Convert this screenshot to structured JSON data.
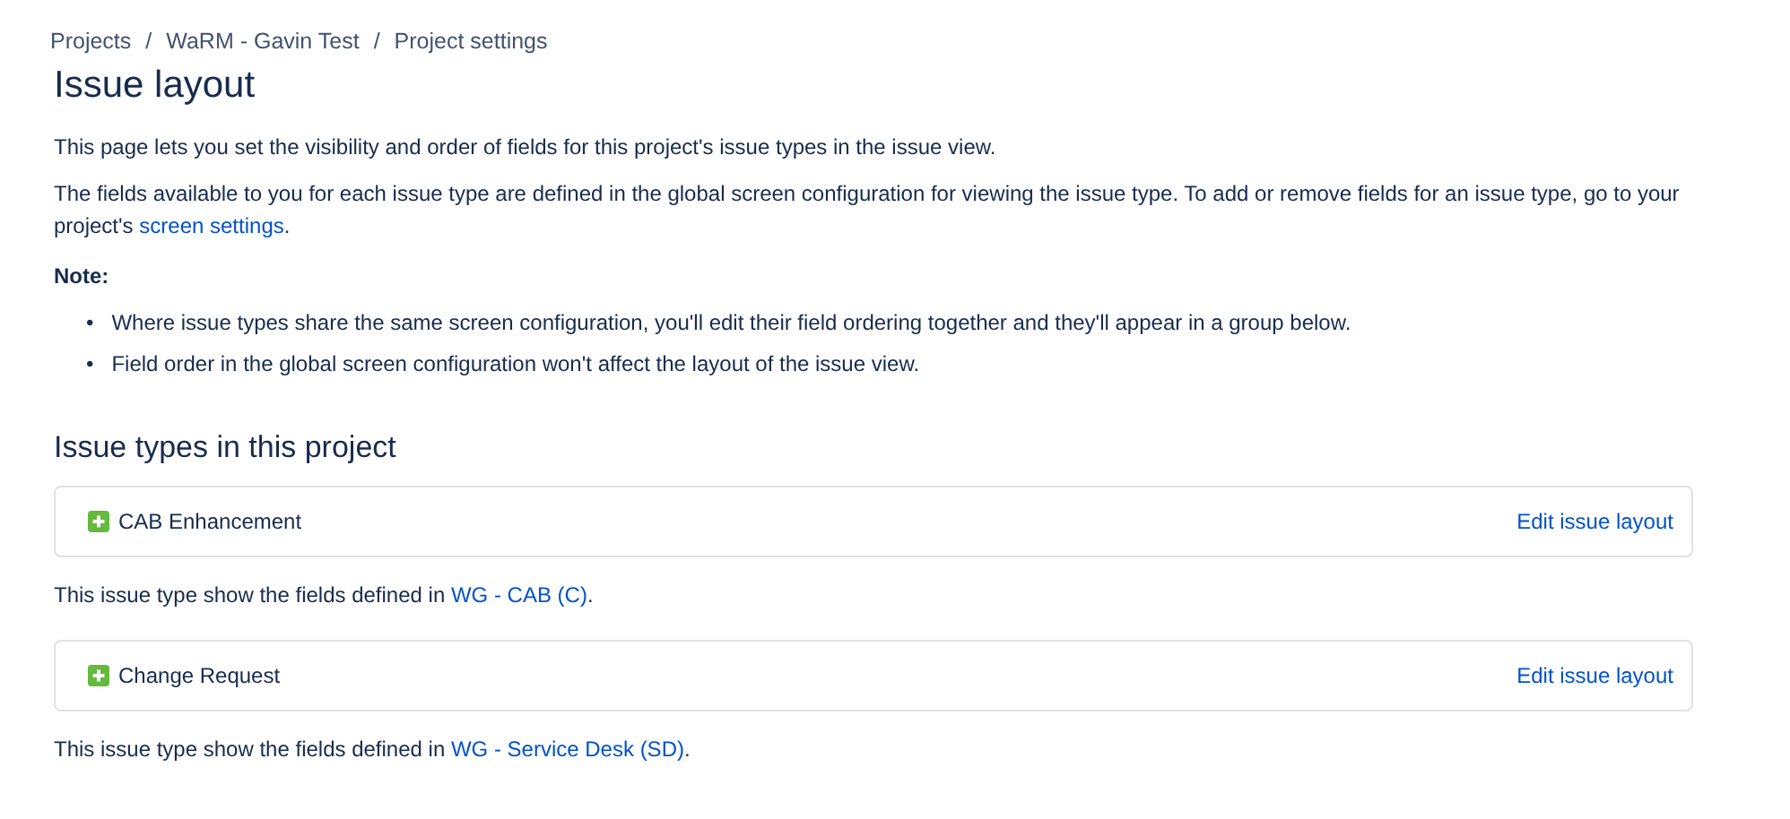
{
  "breadcrumbs": [
    "Projects",
    "WaRM - Gavin Test",
    "Project settings"
  ],
  "breadcrumb_separators": [
    "/",
    "/"
  ],
  "title": "Issue layout",
  "intro": "This page lets you set the visibility and order of fields for this project's issue types in the issue view.",
  "description": {
    "before": "The fields available to you for each issue type are defined in the global screen configuration for viewing the issue type. To add or remove fields for an issue type, go to your project's ",
    "link": "screen settings",
    "after": "."
  },
  "note": {
    "heading": "Note:",
    "bullet": "•",
    "items": [
      "Where issue types share the same screen configuration, you'll edit their field ordering together and they'll appear in a group below.",
      "Field order in the global screen configuration won't affect the layout of the issue view."
    ]
  },
  "section_title": "Issue types in this project",
  "issue_types": [
    {
      "name": "CAB Enhancement",
      "action": "Edit issue layout",
      "caption": {
        "before": "This issue type show the fields defined in ",
        "link": "WG - CAB (C)",
        "after": "."
      }
    },
    {
      "name": "Change Request",
      "action": "Edit issue layout",
      "caption": {
        "before": "This issue type show the fields defined in ",
        "link": "WG - Service Desk (SD)",
        "after": "."
      }
    }
  ]
}
